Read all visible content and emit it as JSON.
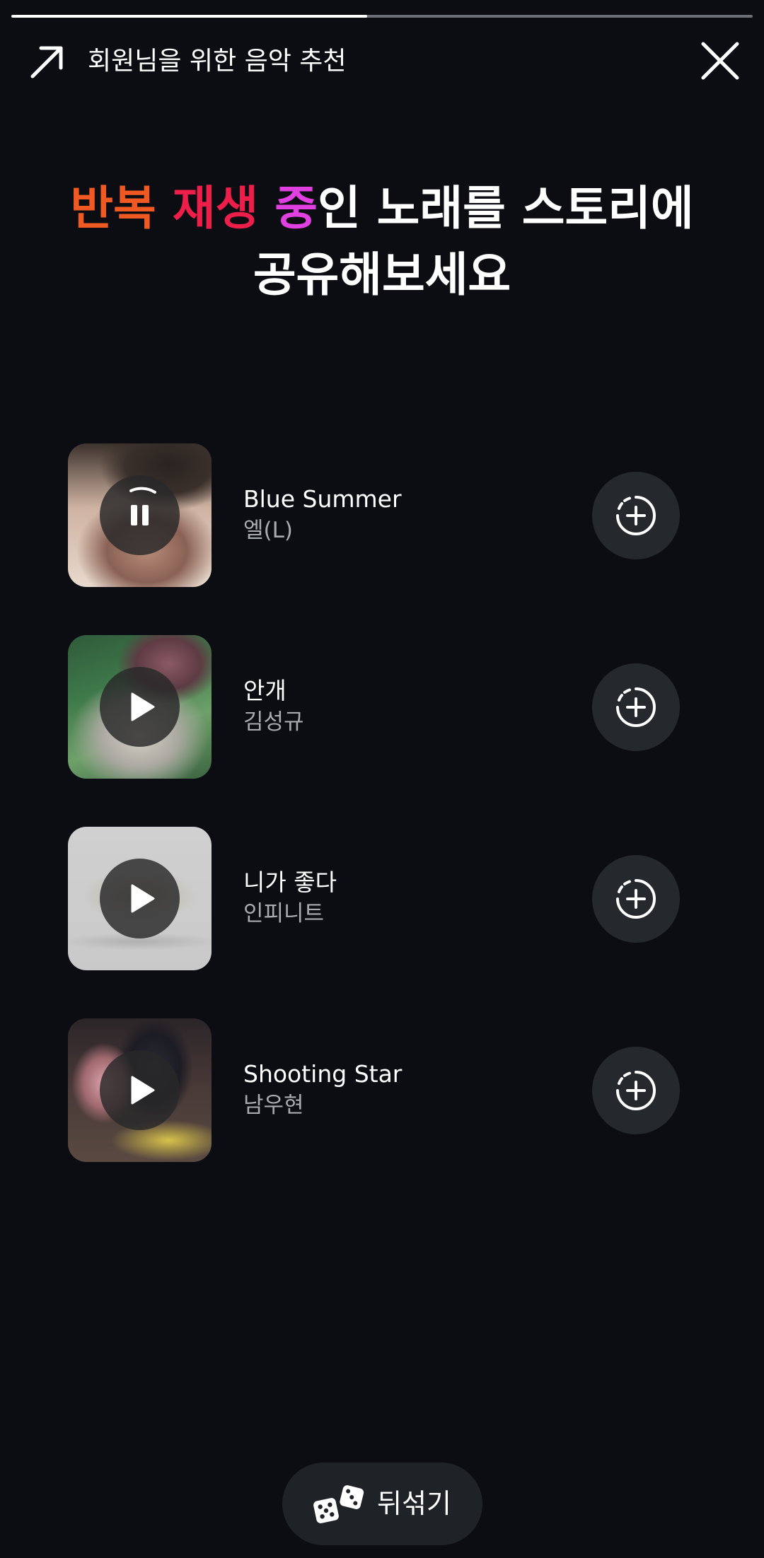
{
  "story_progress": 0.48,
  "header": {
    "title": "회원님을 위한 음악 추천",
    "share_icon": "arrow-up-right-icon",
    "close_icon": "close-icon"
  },
  "headline": {
    "part1": "반복",
    "part2": "재생",
    "part3": "중",
    "rest_line1": "인 노래를 스토리에",
    "line2": "공유해보세요",
    "colors": {
      "part1": "#f05a22",
      "part2": "#ed1f4a",
      "part3": "#e040e0"
    }
  },
  "songs": [
    {
      "title": "Blue Summer",
      "artist": "엘(L)",
      "state": "playing",
      "control_icon": "pause-icon",
      "add_icon": "add-to-story-icon"
    },
    {
      "title": "안개",
      "artist": "김성규",
      "state": "paused",
      "control_icon": "play-icon",
      "add_icon": "add-to-story-icon"
    },
    {
      "title": "니가 좋다",
      "artist": "인피니트",
      "state": "paused",
      "control_icon": "play-icon",
      "add_icon": "add-to-story-icon"
    },
    {
      "title": "Shooting Star",
      "artist": "남우현",
      "state": "paused",
      "control_icon": "play-icon",
      "add_icon": "add-to-story-icon"
    }
  ],
  "shuffle": {
    "label": "뒤섞기",
    "icon": "dice-icon"
  }
}
